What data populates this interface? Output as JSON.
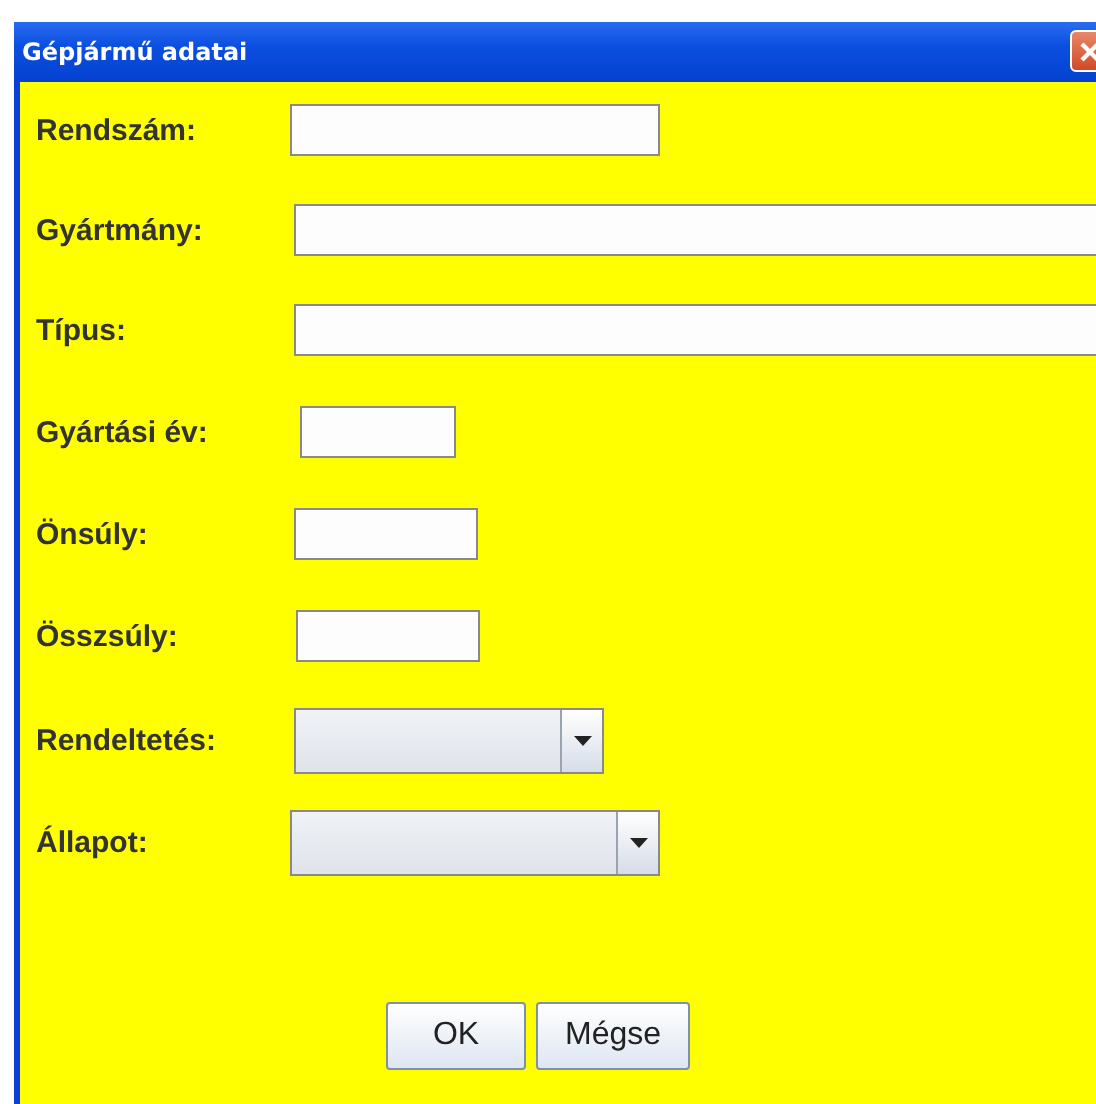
{
  "window": {
    "title": "Gépjármű adatai"
  },
  "fields": [
    {
      "label": "Rendszám:",
      "kind": "text"
    },
    {
      "label": "Gyártmány:",
      "kind": "text"
    },
    {
      "label": "Típus:",
      "kind": "text"
    },
    {
      "label": "Gyártási év:",
      "kind": "text"
    },
    {
      "label": "Önsúly:",
      "kind": "text"
    },
    {
      "label": "Összsúly:",
      "kind": "text"
    },
    {
      "label": "Rendeltetés:",
      "kind": "combo"
    },
    {
      "label": "Állapot:",
      "kind": "combo"
    }
  ],
  "buttons": [
    "OK",
    "Mégse"
  ]
}
